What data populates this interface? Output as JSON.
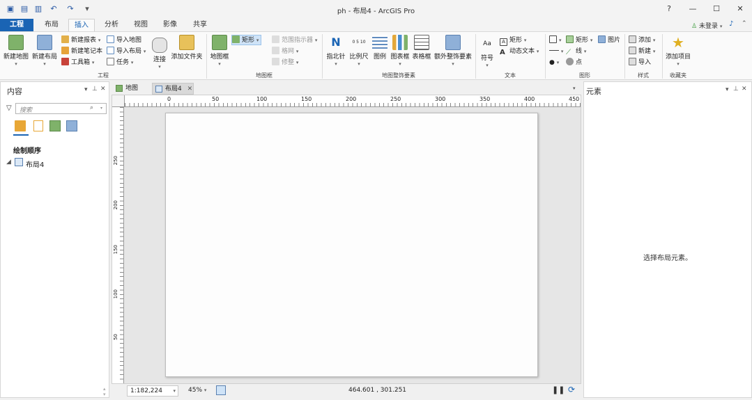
{
  "window": {
    "title": "ph - 布局4 - ArcGIS Pro",
    "help": "?",
    "minimize": "—",
    "maximize": "☐",
    "close": "✕",
    "user": "未登录",
    "colors": {
      "accent": "#1a64b4"
    }
  },
  "tabs": [
    {
      "label": "工程"
    },
    {
      "label": "布局"
    },
    {
      "label": "插入"
    },
    {
      "label": "分析"
    },
    {
      "label": "视图"
    },
    {
      "label": "影像"
    },
    {
      "label": "共享"
    }
  ],
  "ribbon": {
    "project": {
      "new_map": "新建地图",
      "new_layout": "新建布局",
      "new_report": "新建报表",
      "new_notebook": "新建笔记本",
      "toolbox": "工具箱",
      "import_map": "导入地图",
      "import_layout": "导入布局",
      "task": "任务",
      "connect": "连接",
      "add_folder": "添加文件夹",
      "group": "工程"
    },
    "map_frame": {
      "map_frame": "地图框",
      "rectangle": "矩形",
      "extent_indicator": "范围指示器",
      "grid": "格网",
      "reshape": "修整",
      "group": "地图框"
    },
    "surrounds": {
      "north_arrow": "指北针",
      "scale_bar": "比例尺",
      "legend": "图例",
      "chart_frame": "图表框",
      "table_frame": "表格框",
      "extra": "额外整饰要素",
      "scale_ticks": "0 5 10",
      "group": "地图整饰要素"
    },
    "text": {
      "symbol": "符号",
      "rectangle": "矩形",
      "dynamic_text": "动态文本",
      "group": "文本"
    },
    "graphics": {
      "rectangle": "矩形",
      "picture": "图片",
      "line": "线",
      "point": "点",
      "group": "图形"
    },
    "styles": {
      "add": "添加",
      "new": "新建",
      "import": "导入",
      "group": "样式"
    },
    "favorites": {
      "add_item": "添加项目",
      "group": "收藏夹"
    }
  },
  "contents": {
    "title": "内容",
    "search_placeholder": "搜索",
    "drawing_order": "绘制顺序",
    "item": "布局4"
  },
  "view_tabs": [
    {
      "label": "地图"
    },
    {
      "label": "布局4"
    }
  ],
  "ruler": {
    "h": [
      "0",
      "50",
      "100",
      "150",
      "200",
      "250",
      "300",
      "350",
      "400",
      "450"
    ],
    "v": [
      "250",
      "200",
      "150",
      "100",
      "50"
    ]
  },
  "status": {
    "scale": "1:182,224",
    "zoom": "45%",
    "coords": "464.601 , 301.251"
  },
  "elements": {
    "title": "元素",
    "empty": "选择布局元素。"
  }
}
